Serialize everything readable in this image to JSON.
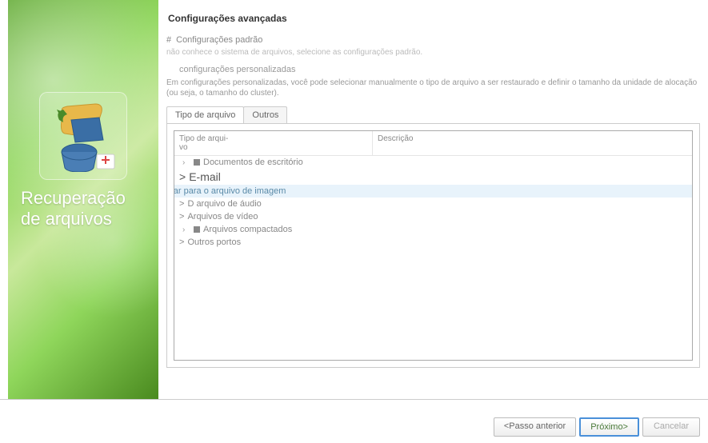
{
  "sidebar": {
    "title_line1": "Recuperação",
    "title_line2": "de arquivos"
  },
  "page": {
    "title": "Configurações avançadas"
  },
  "options": {
    "default": {
      "prefix": "#",
      "label": "Configurações padrão",
      "help_prefix": "não conhece o sistema de arquivos, selecione as configurações padrão."
    },
    "custom": {
      "label": "configurações personalizadas",
      "help": "Em configurações personalizadas, você pode selecionar manualmente o tipo de arquivo a ser restaurado e definir o tamanho da unidade de alocação (ou seja, o tamanho do cluster)."
    }
  },
  "tabs": {
    "file_type": "Tipo de arquivo",
    "others": "Outros"
  },
  "tree": {
    "header_type": "Tipo de arqui-\nvo",
    "header_desc": "Descrição",
    "items": [
      {
        "label": "Documentos de escritório",
        "chev": true,
        "cb": true
      },
      {
        "label": "E-mail",
        "big": true
      },
      {
        "label": "Voltar para o arquivo de imagem",
        "selected": true
      },
      {
        "label": "D arquivo de áudio"
      },
      {
        "label": "Arquivos de vídeo"
      },
      {
        "label": "Arquivos compactados",
        "chev": true,
        "cb": true
      },
      {
        "label": "Outros portos"
      }
    ]
  },
  "buttons": {
    "prev": "<Passo anterior",
    "next": "Próximo>",
    "cancel": "Cancelar"
  }
}
